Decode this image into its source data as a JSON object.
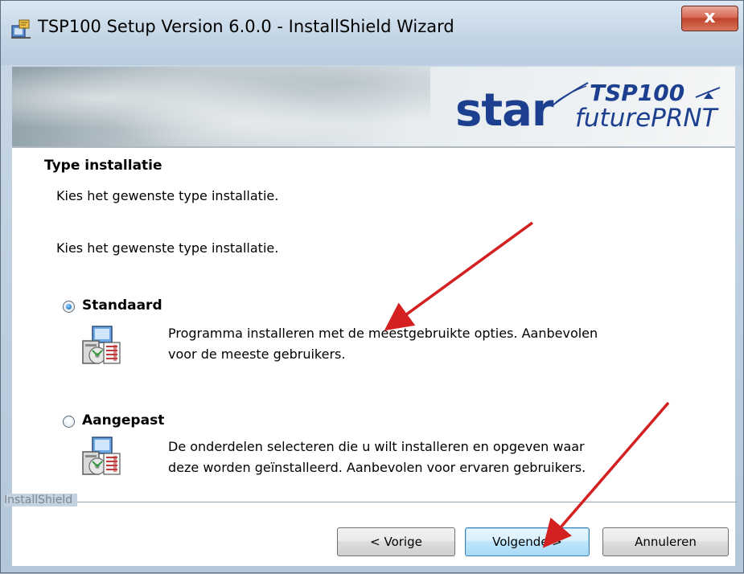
{
  "window": {
    "title": "TSP100 Setup Version 6.0.0 - InstallShield Wizard",
    "close_glyph": "x"
  },
  "banner": {
    "brand": "star",
    "model": "TSP100",
    "subline": "futurePRNT",
    "brand_color": "#1d3f8f"
  },
  "content": {
    "heading": "Type installatie",
    "subtitle": "Kies het gewenste type installatie.",
    "instruction": "Kies het gewenste type installatie.",
    "options": [
      {
        "label": "Standaard",
        "selected": true,
        "description_line1": "Programma installeren met de meestgebruikte opties. Aanbevolen",
        "description_line2": "voor de meeste gebruikers.",
        "icon": "setup-typical-icon"
      },
      {
        "label": "Aangepast",
        "selected": false,
        "description_line1": "De onderdelen selecteren die u wilt installeren en opgeven waar",
        "description_line2": "deze worden geïnstalleerd. Aanbevolen voor ervaren gebruikers.",
        "icon": "setup-custom-icon"
      }
    ]
  },
  "footer": {
    "brand_label": "InstallShield",
    "back_label": "< Vorige",
    "next_label": "Volgende >",
    "cancel_label": "Annuleren"
  },
  "annotations": {
    "arrow_color": "#d42020"
  }
}
